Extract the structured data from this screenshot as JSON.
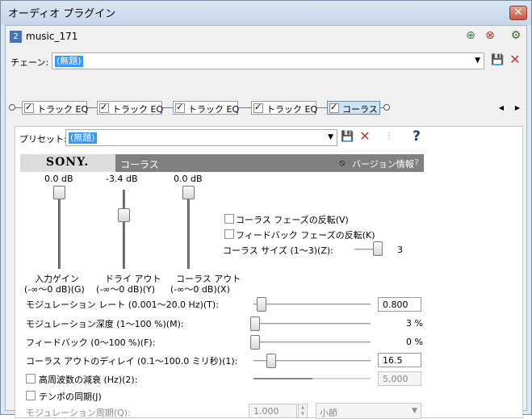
{
  "window": {
    "title": "オーディオ プラグイン",
    "close_glyph": "✕"
  },
  "header": {
    "badge": "2",
    "name": "music_171"
  },
  "chain": {
    "label": "チェーン:",
    "value": "(無題)"
  },
  "plugins": [
    {
      "label": "トラック EQ",
      "checked": true
    },
    {
      "label": "トラック EQ",
      "checked": true
    },
    {
      "label": "トラック EQ",
      "checked": true
    },
    {
      "label": "トラック EQ",
      "checked": true
    },
    {
      "label": "コーラス",
      "checked": true
    }
  ],
  "preset": {
    "label": "プリセット:",
    "value": "(無題)"
  },
  "banner": {
    "brand": "SONY.",
    "name": "コーラス",
    "version": "バージョン情報",
    "help": "?"
  },
  "faders": [
    {
      "value_text": "0.0 dB",
      "label1": "入力ゲイン",
      "label2": "(-∞〜0 dB)(G)",
      "level": 0.0
    },
    {
      "value_text": "-3.4 dB",
      "label1": "ドライ アウト",
      "label2": "(-∞〜0 dB)(Y)",
      "level": 0.3
    },
    {
      "value_text": "0.0 dB",
      "label1": "コーラス アウト",
      "label2": "(-∞〜0 dB)(X)",
      "level": 0.0
    }
  ],
  "options": {
    "invert_chorus": "コーラス フェーズの反転(V)",
    "invert_feedback": "フィードバック フェーズの反転(K)",
    "chorus_size_label": "コーラス サイズ (1〜3)(Z):",
    "chorus_size_value": "3"
  },
  "params": [
    {
      "label": "モジュレーション レート (0.001〜20.0 Hz)(T):",
      "value": "0.800",
      "boxed": true
    },
    {
      "label": "モジュレーション深度 (1〜100 %)(M):",
      "value": "3 %",
      "boxed": false
    },
    {
      "label": "フィードバック (0〜100 %)(F):",
      "value": "0 %",
      "boxed": false
    },
    {
      "label": "コーラス アウトのディレイ (0.1〜100.0 ミリ秒)(1):",
      "value": "16.5",
      "boxed": true
    },
    {
      "label": "高周波数の減衰 (Hz)(2):",
      "value": "5,000",
      "boxed": true
    }
  ],
  "tempo": {
    "label": "テンポの同期(J)",
    "period_label": "モジュレーション周期(Q):",
    "period_value": "1.000",
    "unit": "小節"
  }
}
